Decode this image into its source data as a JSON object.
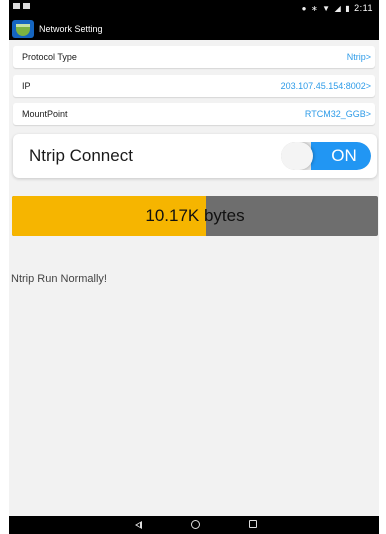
{
  "status_bar": {
    "time": "2:11",
    "icons": [
      "location-icon",
      "bluetooth-icon",
      "wifi-icon",
      "signal-icon",
      "battery-icon"
    ]
  },
  "app_bar": {
    "title": "Network Setting",
    "icon": "app-logo-icon"
  },
  "settings": {
    "protocol": {
      "label": "Protocol Type",
      "value": "Ntrip>"
    },
    "ip": {
      "label": "IP",
      "value": "203.107.45.154:8002>"
    },
    "mountpoint": {
      "label": "MountPoint",
      "value": "RTCM32_GGB>"
    }
  },
  "ntrip_connect": {
    "label": "Ntrip Connect",
    "toggle_text": "ON",
    "toggle_color": "#2196f3"
  },
  "progress": {
    "text": "10.17K bytes",
    "fill_fraction": 0.53,
    "fill_color": "#f6b500",
    "track_color": "#6e6e6e"
  },
  "status_message": "Ntrip Run Normally!",
  "nav_bar": {
    "buttons": [
      "back-icon",
      "home-icon",
      "recent-apps-icon"
    ]
  }
}
